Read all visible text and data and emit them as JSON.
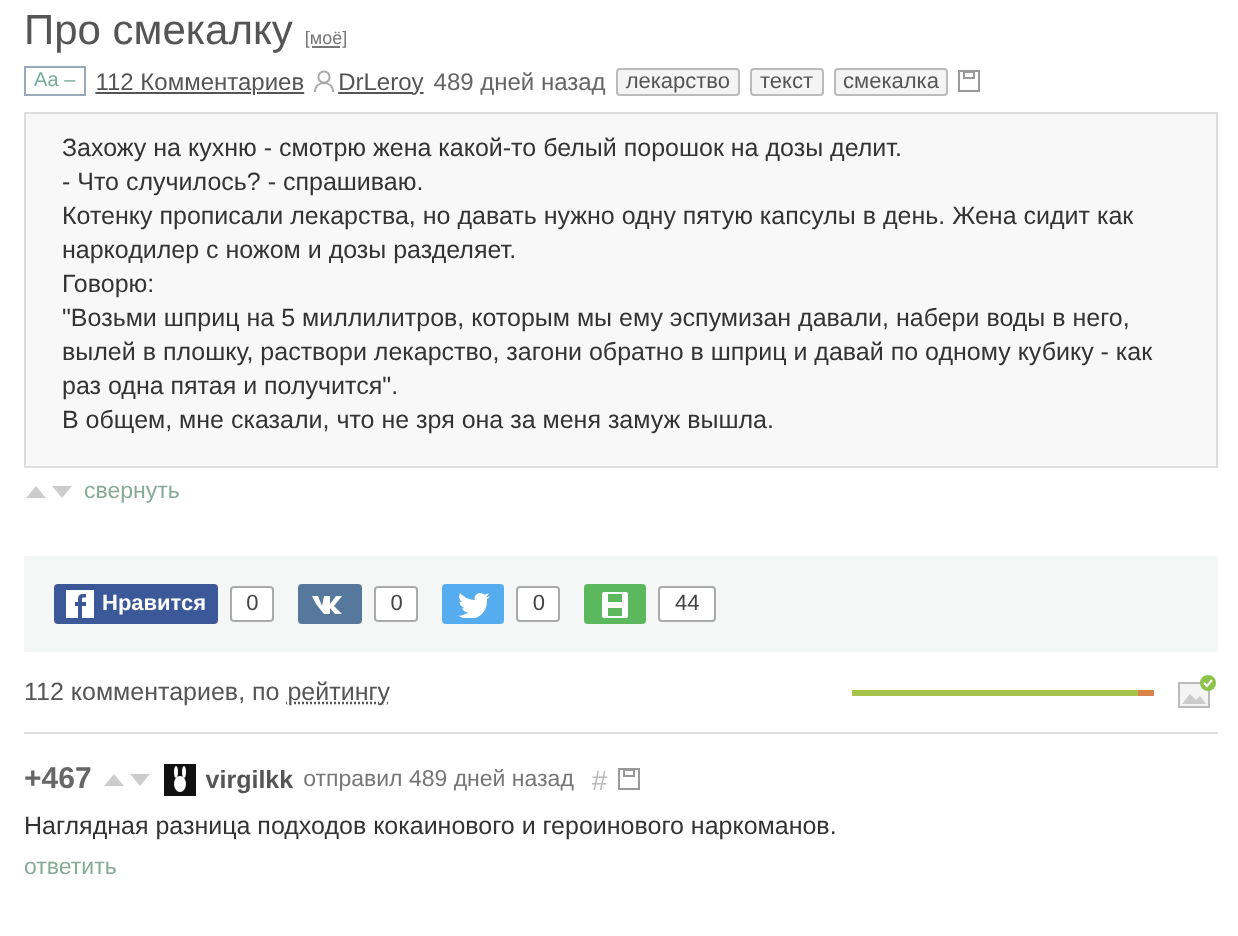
{
  "post": {
    "title": "Про смекалку",
    "mine_tag": "[моё]",
    "font_toggle": "Аа –",
    "comments_link": "112 Комментариев",
    "author": "DrLeroy",
    "time": "489 дней назад",
    "tags": [
      "лекарство",
      "текст",
      "смекалка"
    ],
    "paragraphs": [
      "Захожу на кухню - смотрю жена какой-то белый порошок на дозы делит.",
      "- Что случилось? - спрашиваю.",
      "Котенку прописали лекарства, но давать нужно одну пятую капсулы в день. Жена сидит как наркодилер с ножом и дозы разделяет.",
      "Говорю:",
      "\"Возьми шприц на 5 миллилитров, которым мы ему эспумизан давали, набери воды в него, вылей в плошку, раствори лекарство, загони обратно в шприц и давай по одному кубику - как раз одна пятая и получится\".",
      "В общем, мне сказали, что не зря она за меня замуж вышла."
    ],
    "collapse": "свернуть"
  },
  "share": [
    {
      "kind": "facebook",
      "label": "Нравится",
      "count": "0"
    },
    {
      "kind": "vk",
      "count": "0"
    },
    {
      "kind": "twitter",
      "count": "0"
    },
    {
      "kind": "save",
      "count": "44"
    }
  ],
  "comments_header": {
    "count_text": "112 комментариев, по",
    "sort_link": "рейтингу",
    "level": 0.95
  },
  "comments": [
    {
      "rating": "+467",
      "author": "virgilkk",
      "meta": "отправил 489 дней назад",
      "hash": "#",
      "text": "Наглядная разница подходов кокаинового и героинового наркоманов.",
      "reply": "ответить"
    }
  ]
}
